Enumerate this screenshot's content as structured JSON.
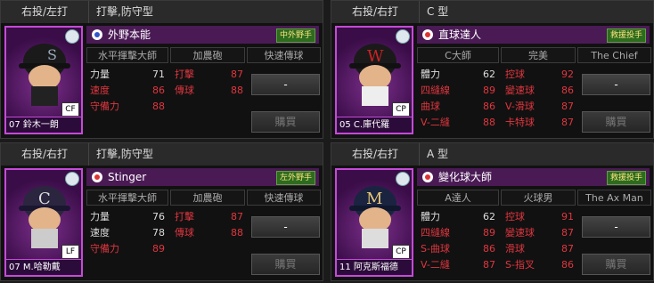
{
  "cards": [
    {
      "hand": "右投/左打",
      "style": "打擊,防守型",
      "player_label": "07 鈴木一朗",
      "position": "CF",
      "name": "外野本能",
      "role": "中外野手",
      "tags": [
        "水平揮擊大師",
        "加農砲",
        "快速傳球"
      ],
      "stats": [
        {
          "l1": "力量",
          "v1": "71",
          "l2": "打擊",
          "v2": "87",
          "red1": false
        },
        {
          "l1": "速度",
          "v1": "86",
          "l2": "傳球",
          "v2": "88",
          "red1": true
        },
        {
          "l1": "守備力",
          "v1": "88",
          "l2": "",
          "v2": "",
          "red1": true
        }
      ],
      "select_value": "-",
      "buy_label": "購買"
    },
    {
      "hand": "右投/右打",
      "style": "C 型",
      "player_label": "05 C.庫代羅",
      "position": "CP",
      "name": "直球達人",
      "role": "救援投手",
      "tags": [
        "C大師",
        "完美",
        "The Chief"
      ],
      "stats": [
        {
          "l1": "體力",
          "v1": "62",
          "l2": "控球",
          "v2": "92"
        },
        {
          "l1": "四縫線",
          "v1": "89",
          "l2": "變速球",
          "v2": "86"
        },
        {
          "l1": "曲球",
          "v1": "86",
          "l2": "V-滑球",
          "v2": "87"
        },
        {
          "l1": "V-二縫",
          "v1": "88",
          "l2": "卡特球",
          "v2": "87"
        }
      ],
      "select_value": "-",
      "buy_label": "購買"
    },
    {
      "hand": "右投/右打",
      "style": "打擊,防守型",
      "player_label": "07 M.哈勒戴",
      "position": "LF",
      "name": "Stinger",
      "role": "左外野手",
      "tags": [
        "水平揮擊大師",
        "加農砲",
        "快速傳球"
      ],
      "stats": [
        {
          "l1": "力量",
          "v1": "76",
          "l2": "打擊",
          "v2": "87",
          "red1": false
        },
        {
          "l1": "速度",
          "v1": "78",
          "l2": "傳球",
          "v2": "88",
          "red1": false
        },
        {
          "l1": "守備力",
          "v1": "89",
          "l2": "",
          "v2": "",
          "red1": true
        }
      ],
      "select_value": "-",
      "buy_label": "購買"
    },
    {
      "hand": "右投/右打",
      "style": "A 型",
      "player_label": "11 阿克斯福德",
      "position": "CP",
      "name": "變化球大師",
      "role": "救援投手",
      "tags": [
        "A達人",
        "火球男",
        "The Ax Man"
      ],
      "stats": [
        {
          "l1": "體力",
          "v1": "62",
          "l2": "控球",
          "v2": "91"
        },
        {
          "l1": "四縫線",
          "v1": "89",
          "l2": "變速球",
          "v2": "87"
        },
        {
          "l1": "S-曲球",
          "v1": "86",
          "l2": "滑球",
          "v2": "87"
        },
        {
          "l1": "V-二縫",
          "v1": "87",
          "l2": "S-指叉",
          "v2": "86"
        }
      ],
      "select_value": "-",
      "buy_label": "購買"
    }
  ]
}
